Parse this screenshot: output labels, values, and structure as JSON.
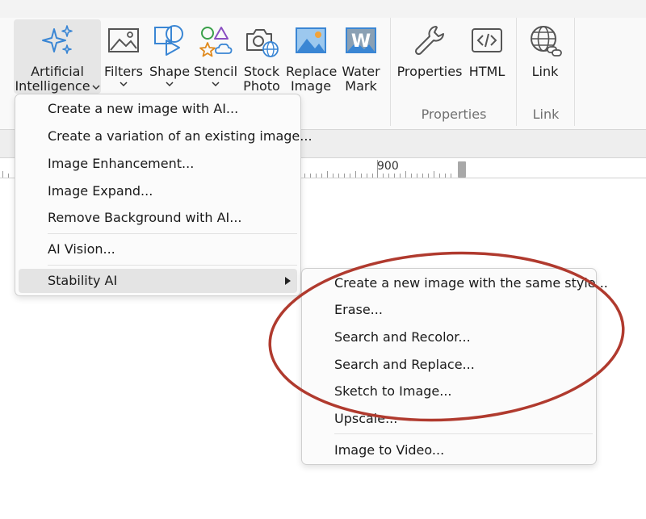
{
  "ribbon": {
    "buttons": [
      {
        "id": "ai",
        "line1": "Artificial",
        "line2": "Intelligence",
        "dropdown": true,
        "active": true,
        "icon": "sparkles-icon"
      },
      {
        "id": "filters",
        "line1": "Filters",
        "dropdown": true,
        "icon": "image-icon"
      },
      {
        "id": "shape",
        "line1": "Shape",
        "dropdown": true,
        "icon": "shapes-icon"
      },
      {
        "id": "stencil",
        "line1": "Stencil",
        "dropdown": true,
        "icon": "stencil-icon"
      },
      {
        "id": "stock",
        "line1": "Stock",
        "line2": "Photo",
        "icon": "camera-globe-icon"
      },
      {
        "id": "replace",
        "line1": "Replace",
        "line2": "Image",
        "icon": "landscape-icon"
      },
      {
        "id": "watermark",
        "line1": "Water",
        "line2": "Mark",
        "icon": "watermark-icon"
      },
      {
        "id": "properties",
        "line1": "Properties",
        "icon": "wrench-icon"
      },
      {
        "id": "html",
        "line1": "HTML",
        "icon": "code-icon"
      },
      {
        "id": "link",
        "line1": "Link",
        "icon": "globe-link-icon"
      }
    ],
    "groups": {
      "properties_label": "Properties",
      "link_label": "Link"
    },
    "watermark_letter": "W"
  },
  "ruler": {
    "label": "900"
  },
  "menu": {
    "items": [
      "Create a new image with AI...",
      "Create a variation of an existing image...",
      "Image Enhancement...",
      "Image Expand...",
      "Remove Background with AI...",
      "AI Vision...",
      "Stability AI"
    ],
    "highlighted": "Stability AI"
  },
  "submenu": {
    "items": [
      "Create a new image with the same style...",
      "Erase...",
      "Search and Recolor...",
      "Search and Replace...",
      "Sketch to Image...",
      "Upscale...",
      "Image to Video..."
    ]
  },
  "colors": {
    "annotation": "#b03a2e",
    "ai_icon": "#3a86d4",
    "hover": "#e4e4e4"
  }
}
